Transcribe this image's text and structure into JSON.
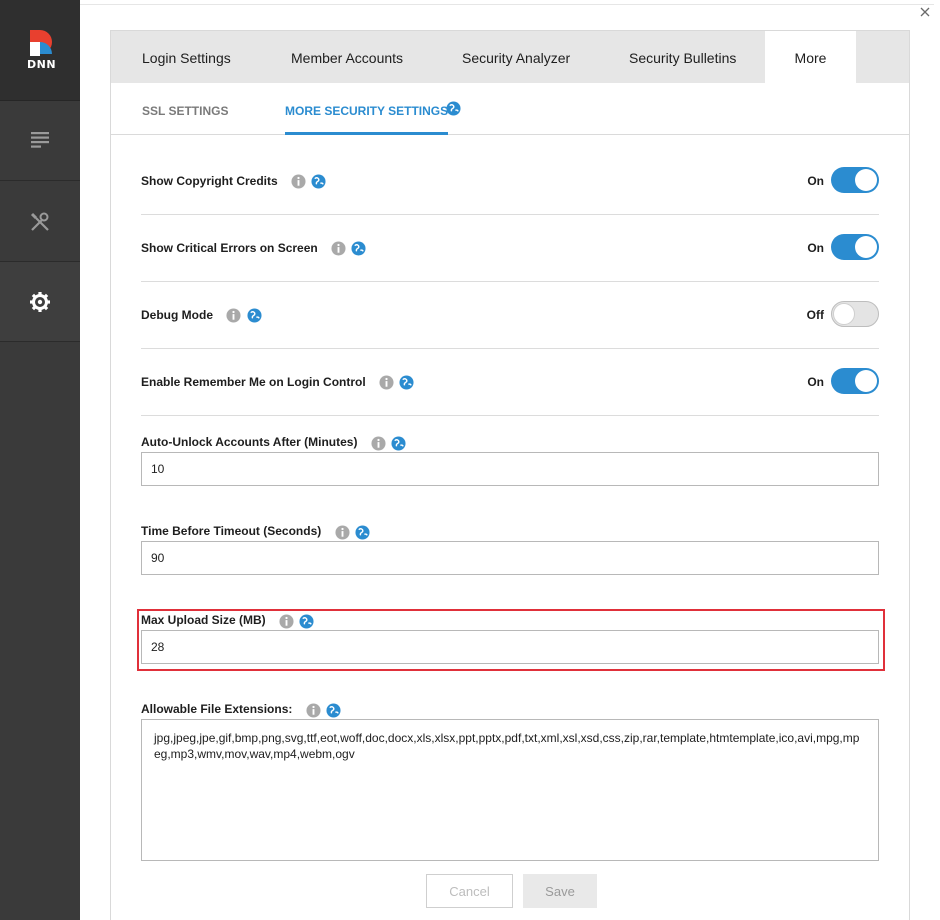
{
  "rail": {
    "logo_text": "DNN",
    "items": [
      {
        "icon": "content-icon"
      },
      {
        "icon": "tools-icon"
      },
      {
        "icon": "gear-icon"
      }
    ]
  },
  "tabs": [
    "Login Settings",
    "Member Accounts",
    "Security Analyzer",
    "Security Bulletins",
    "More"
  ],
  "subtabs": [
    "SSL SETTINGS",
    "MORE SECURITY SETTINGS"
  ],
  "toggles": [
    {
      "label": "Show Copyright Credits",
      "state": "On"
    },
    {
      "label": "Show Critical Errors on Screen",
      "state": "On"
    },
    {
      "label": "Debug Mode",
      "state": "Off"
    },
    {
      "label": "Enable Remember Me on Login Control",
      "state": "On"
    }
  ],
  "fields": {
    "auto_unlock": {
      "label": "Auto-Unlock Accounts After (Minutes)",
      "value": "10"
    },
    "timeout": {
      "label": "Time Before Timeout (Seconds)",
      "value": "90"
    },
    "max_upload": {
      "label": "Max Upload Size (MB)",
      "value": "28"
    },
    "extensions": {
      "label": "Allowable File Extensions:",
      "value": "jpg,jpeg,jpe,gif,bmp,png,svg,ttf,eot,woff,doc,docx,xls,xlsx,ppt,pptx,pdf,txt,xml,xsl,xsd,css,zip,rar,template,htmtemplate,ico,avi,mpg,mpeg,mp3,wmv,mov,wav,mp4,webm,ogv"
    }
  },
  "buttons": {
    "cancel": "Cancel",
    "save": "Save"
  },
  "colors": {
    "accent": "#2b8cd0",
    "highlight": "#e0303a",
    "rail": "#3a3a3a"
  }
}
